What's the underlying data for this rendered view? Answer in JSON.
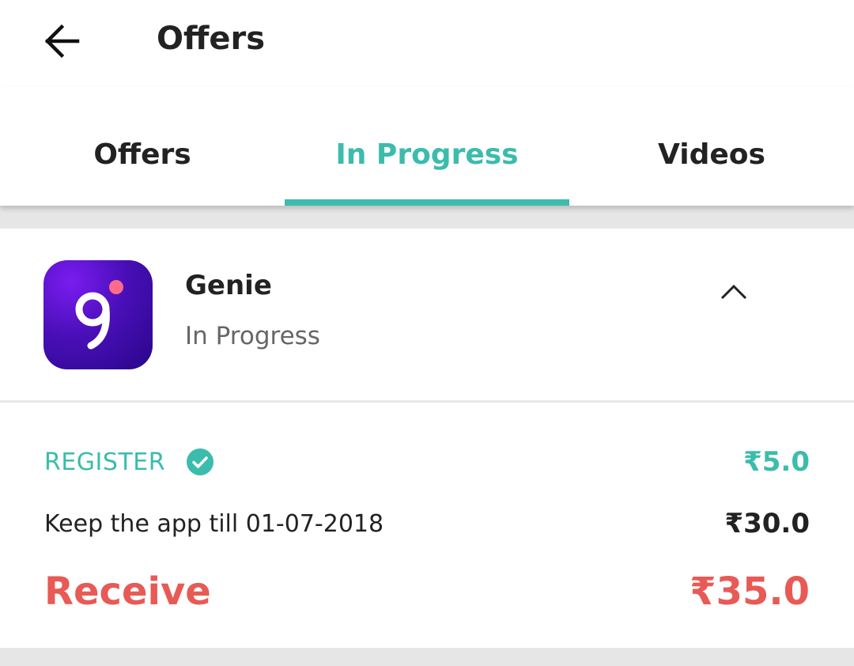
{
  "appbar": {
    "title": "Offers",
    "back_icon": "arrow-left-icon"
  },
  "tabs": [
    {
      "label": "Offers",
      "active": false
    },
    {
      "label": "In Progress",
      "active": true
    },
    {
      "label": "Videos",
      "active": false
    }
  ],
  "offer": {
    "app_name": "Genie",
    "status": "In Progress",
    "icon": "genie-app-icon",
    "expand_icon": "chevron-up-icon",
    "tasks": [
      {
        "label": "REGISTER",
        "amount": "₹5.0",
        "completed": true,
        "status_icon": "check-circle-icon"
      },
      {
        "label": "Keep the app till 01-07-2018",
        "amount": "₹30.0",
        "completed": false
      }
    ],
    "total": {
      "label": "Receive",
      "amount": "₹35.0"
    }
  },
  "colors": {
    "accent": "#3bbcac",
    "total": "#e85a55",
    "text": "#222222",
    "app_icon_gradient": [
      "#7a1cf0",
      "#28068a"
    ],
    "app_icon_dot": "#ff6b8a"
  }
}
